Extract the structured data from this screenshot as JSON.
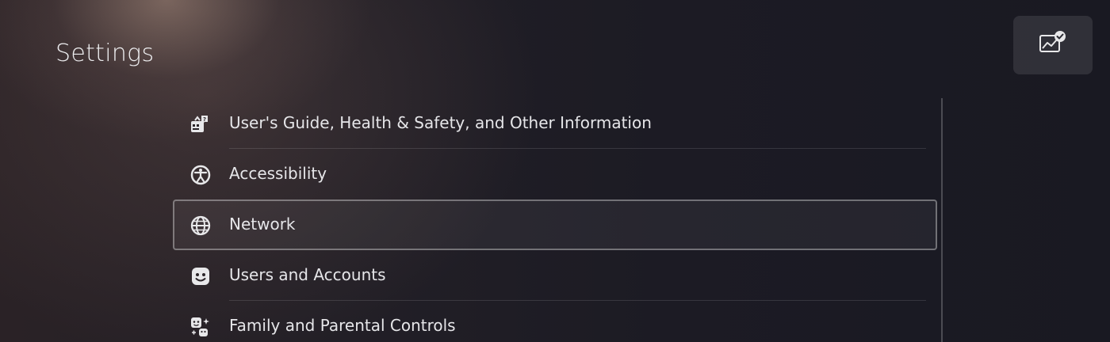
{
  "page": {
    "title": "Settings"
  },
  "corner_button": {
    "icon": "chart-check-icon"
  },
  "menu": {
    "items": [
      {
        "label": "User's Guide, Health & Safety, and Other Information",
        "icon": "guide-info-icon",
        "selected": false
      },
      {
        "label": "Accessibility",
        "icon": "accessibility-icon",
        "selected": false
      },
      {
        "label": "Network",
        "icon": "globe-icon",
        "selected": true
      },
      {
        "label": "Users and Accounts",
        "icon": "user-face-icon",
        "selected": false
      },
      {
        "label": "Family and Parental Controls",
        "icon": "family-icon",
        "selected": false
      }
    ]
  },
  "colors": {
    "background": "#1a1a24",
    "text": "#e6e6e9",
    "highlight_border": "#8a8a90"
  }
}
